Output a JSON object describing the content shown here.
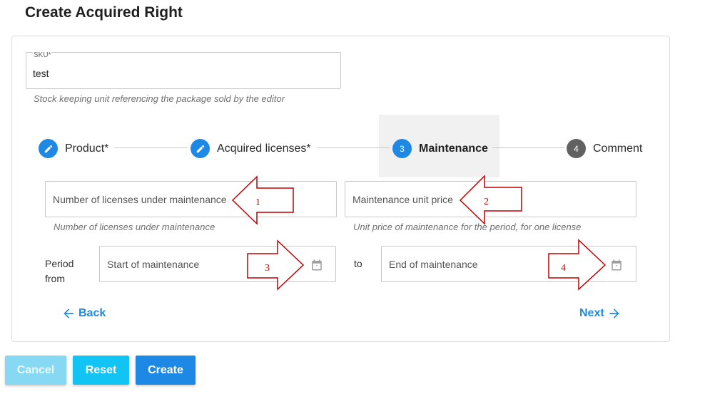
{
  "page": {
    "title": "Create Acquired Right"
  },
  "sku": {
    "label": "SKU*",
    "value": "test",
    "helper": "Stock keeping unit referencing the package sold by the editor"
  },
  "stepper": {
    "steps": [
      {
        "label": "Product*",
        "icon": "pencil-icon",
        "state": "completed"
      },
      {
        "label": "Acquired licenses*",
        "icon": "pencil-icon",
        "state": "completed"
      },
      {
        "number": "3",
        "label": "Maintenance",
        "state": "active"
      },
      {
        "number": "4",
        "label": "Comment",
        "state": "pending"
      }
    ]
  },
  "maintenance": {
    "licenses_placeholder": "Number of licenses under maintenance",
    "licenses_helper": "Number of licenses under maintenance",
    "price_placeholder": "Maintenance unit price",
    "price_helper": "Unit price of maintenance for the period, for one license",
    "period_label": "Period from",
    "to_label": "to",
    "start_placeholder": "Start of maintenance",
    "end_placeholder": "End of maintenance"
  },
  "nav": {
    "back_label": "Back",
    "next_label": "Next"
  },
  "actions": {
    "cancel_label": "Cancel",
    "reset_label": "Reset",
    "create_label": "Create"
  },
  "annotations": [
    "1",
    "2",
    "3",
    "4"
  ],
  "colors": {
    "primary": "#1e88e5",
    "reset": "#11c4f4",
    "cancel_disabled": "#87d9f3",
    "step_pending": "#616161",
    "annotation": "#c00000"
  }
}
